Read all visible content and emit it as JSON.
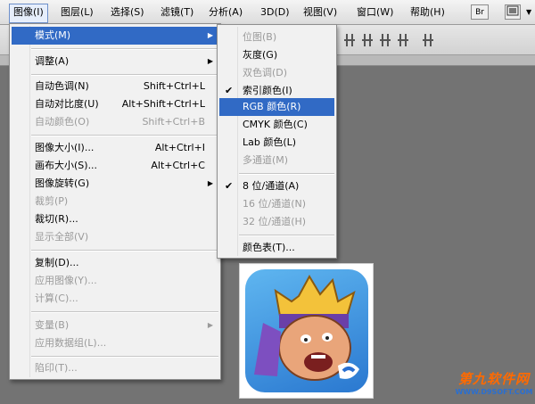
{
  "menubar": {
    "items": [
      "图像(I)",
      "图层(L)",
      "选择(S)",
      "滤镜(T)",
      "分析(A)",
      "3D(D)",
      "视图(V)",
      "窗口(W)",
      "帮助(H)"
    ],
    "br_label": "Br"
  },
  "image_menu": {
    "items": [
      {
        "label": "模式(M)",
        "shortcut": "",
        "submenu": true,
        "disabled": false
      },
      {
        "label": "调整(A)",
        "shortcut": "",
        "submenu": true,
        "disabled": false
      },
      {
        "label": "自动色调(N)",
        "shortcut": "Shift+Ctrl+L",
        "disabled": false
      },
      {
        "label": "自动对比度(U)",
        "shortcut": "Alt+Shift+Ctrl+L",
        "disabled": false
      },
      {
        "label": "自动颜色(O)",
        "shortcut": "Shift+Ctrl+B",
        "disabled": true
      },
      {
        "label": "图像大小(I)...",
        "shortcut": "Alt+Ctrl+I",
        "disabled": false
      },
      {
        "label": "画布大小(S)...",
        "shortcut": "Alt+Ctrl+C",
        "disabled": false
      },
      {
        "label": "图像旋转(G)",
        "shortcut": "",
        "submenu": true,
        "disabled": false
      },
      {
        "label": "裁剪(P)",
        "shortcut": "",
        "disabled": true
      },
      {
        "label": "裁切(R)...",
        "shortcut": "",
        "disabled": false
      },
      {
        "label": "显示全部(V)",
        "shortcut": "",
        "disabled": true
      },
      {
        "label": "复制(D)...",
        "shortcut": "",
        "disabled": false
      },
      {
        "label": "应用图像(Y)...",
        "shortcut": "",
        "disabled": true
      },
      {
        "label": "计算(C)...",
        "shortcut": "",
        "disabled": true
      },
      {
        "label": "变量(B)",
        "shortcut": "",
        "submenu": true,
        "disabled": true
      },
      {
        "label": "应用数据组(L)...",
        "shortcut": "",
        "disabled": true
      },
      {
        "label": "陷印(T)...",
        "shortcut": "",
        "disabled": true
      }
    ]
  },
  "mode_menu": {
    "items": [
      {
        "label": "位图(B)",
        "disabled": true
      },
      {
        "label": "灰度(G)",
        "disabled": false
      },
      {
        "label": "双色调(D)",
        "disabled": true
      },
      {
        "label": "索引颜色(I)",
        "disabled": false,
        "checked": true
      },
      {
        "label": "RGB 颜色(R)",
        "disabled": false,
        "highlighted": true
      },
      {
        "label": "CMYK 颜色(C)",
        "disabled": false
      },
      {
        "label": "Lab 颜色(L)",
        "disabled": false
      },
      {
        "label": "多通道(M)",
        "disabled": true
      },
      {
        "label": "8 位/通道(A)",
        "disabled": false,
        "checked": true
      },
      {
        "label": "16 位/通道(N)",
        "disabled": true
      },
      {
        "label": "32 位/通道(H)",
        "disabled": true
      },
      {
        "label": "颜色表(T)...",
        "disabled": false
      }
    ]
  },
  "watermark": {
    "title": "第九软件网",
    "url": "WWW.D9SOFT.COM"
  },
  "colors": {
    "highlight": "#316ac5",
    "disabled_text": "#9a9a9a",
    "menu_bg": "#f1f1f1"
  }
}
